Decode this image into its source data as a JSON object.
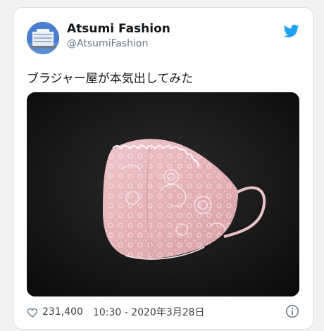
{
  "tweet": {
    "display_name": "Atsumi Fashion",
    "handle": "@AtsumiFashion",
    "text": "ブラジャー屋が本気出してみた",
    "like_count": "231,400",
    "timestamp": "10:30 - 2020年3月28日"
  },
  "icons": {
    "platform": "twitter-bird-icon",
    "like": "heart-icon",
    "info": "info-icon"
  },
  "colors": {
    "twitter_blue": "#1da1f2",
    "mask_pink": "#e6b6bb"
  }
}
